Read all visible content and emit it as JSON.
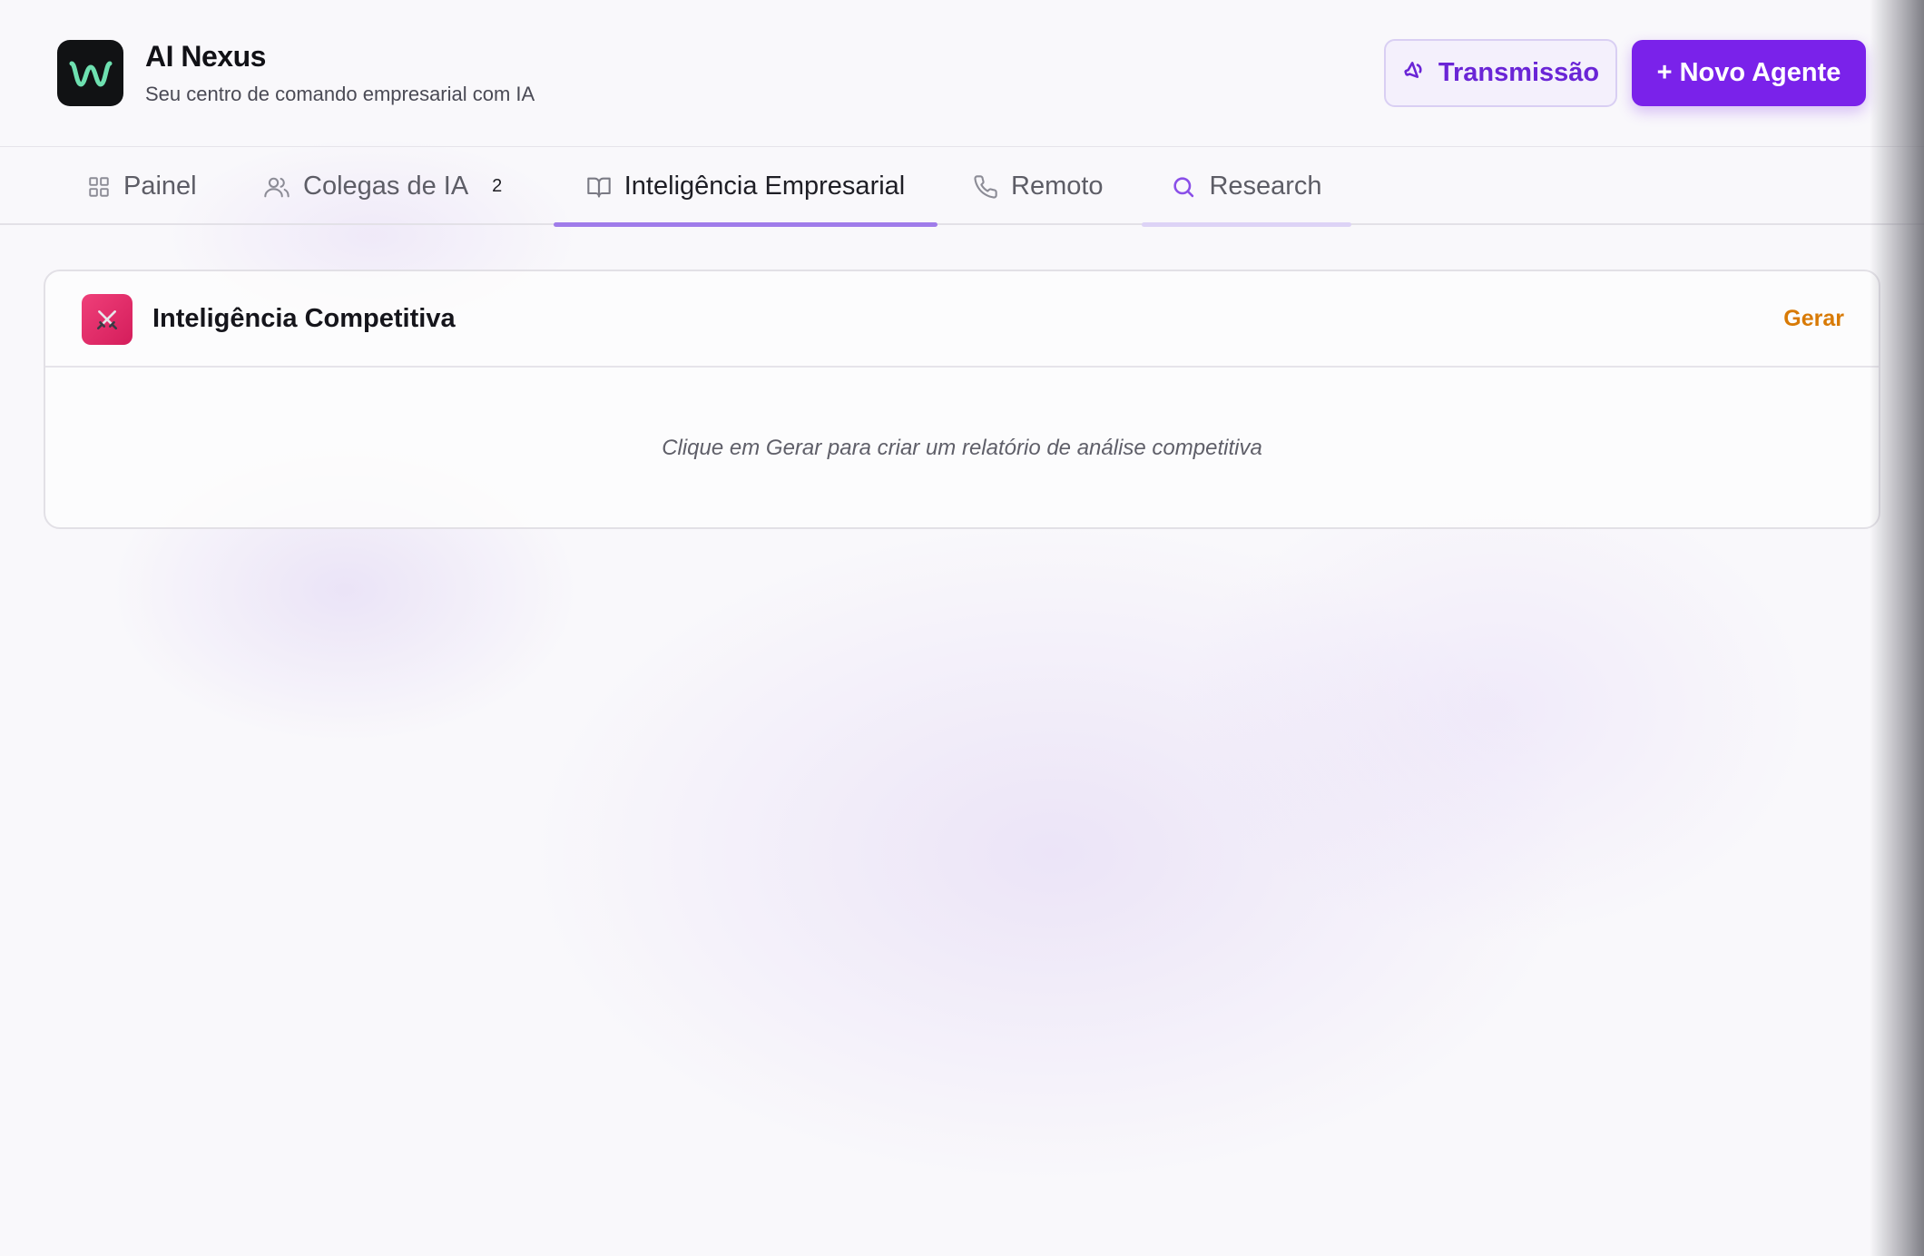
{
  "app": {
    "title": "AI Nexus",
    "subtitle": "Seu centro de comando empresarial com IA",
    "logo_icon": "wave-logo-icon"
  },
  "header": {
    "broadcast_label": "Transmissão",
    "broadcast_icon": "megaphone-icon",
    "new_agent_label": "+ Novo Agente"
  },
  "tabs": [
    {
      "label": "Painel",
      "icon": "grid-icon",
      "active": false
    },
    {
      "label": "Colegas de IA",
      "icon": "users-icon",
      "badge": "2",
      "active": false
    },
    {
      "label": "Inteligência Empresarial",
      "icon": "book-icon",
      "active": true
    },
    {
      "label": "Remoto",
      "icon": "phone-icon",
      "active": false
    },
    {
      "label": "Research",
      "icon": "search-icon",
      "active": false
    }
  ],
  "card": {
    "icon": "crossed-swords-icon",
    "title": "Inteligência Competitiva",
    "action_label": "Gerar",
    "empty_message": "Clique em Gerar para criar um relatório de análise competitiva"
  },
  "colors": {
    "accent": "#7a22ea",
    "active_tab_underline": "#a07cea",
    "action": "#d87a06",
    "card_icon_bg": "#e0306b",
    "logo_bg": "#111214",
    "logo_wave": "#6ee0b0"
  }
}
